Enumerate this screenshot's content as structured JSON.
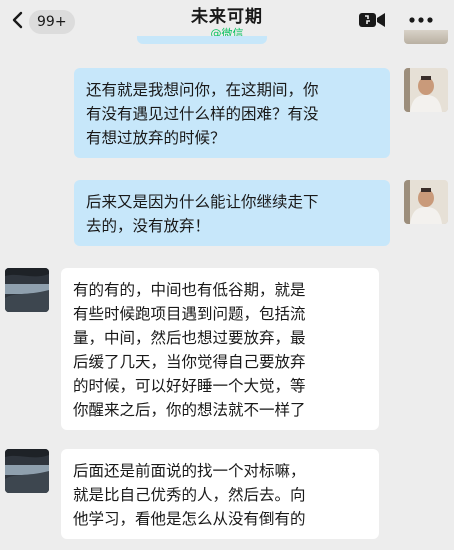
{
  "header": {
    "back_icon": "chevron-left-icon",
    "unread_count": "99+",
    "title": "未来可期",
    "subtitle": "@微信",
    "video_icon": "video-call-icon",
    "more_icon": "more-dots-icon"
  },
  "colors": {
    "background": "#ededed",
    "outgoing_bubble": "#c7e7fa",
    "incoming_bubble": "#ffffff",
    "subtitle": "#07c160"
  },
  "messages": [
    {
      "sender": "me",
      "text": "还有就是我想问你，在这期间，你\n有没有遇见过什么样的困难？有没\n有想过放弃的时候？"
    },
    {
      "sender": "me",
      "text": "后来又是因为什么能让你继续走下\n去的，没有放弃！"
    },
    {
      "sender": "them",
      "text": "有的有的，中间也有低谷期，就是\n有些时候跑项目遇到问题，包括流\n量，中间，然后也想过要放弃，最\n后缓了几天，当你觉得自己要放弃\n的时候，可以好好睡一个大觉，等\n你醒来之后，你的想法就不一样了"
    },
    {
      "sender": "them",
      "text": "后面还是前面说的找一个对标嘛，\n就是比自己优秀的人，然后去。向\n他学习，看他是怎么从没有倒有的"
    }
  ]
}
